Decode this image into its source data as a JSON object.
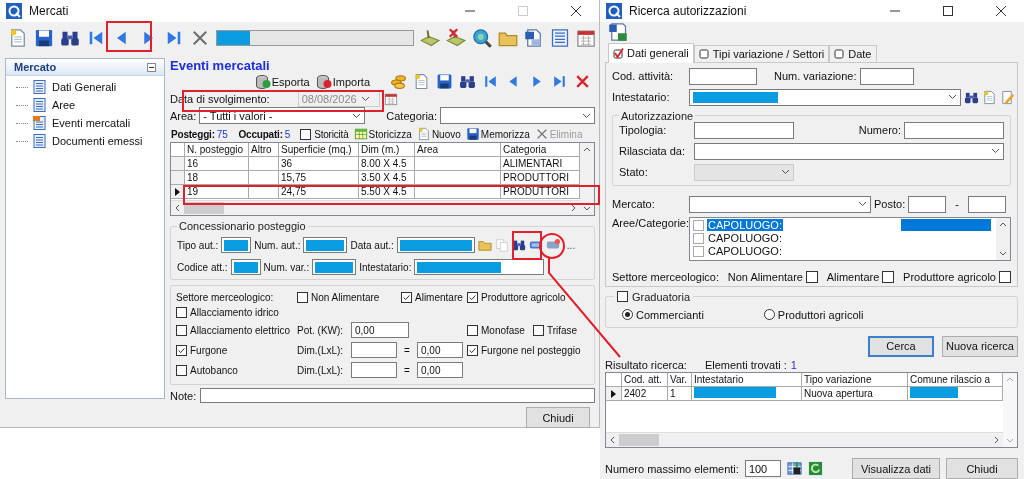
{
  "mercati_window": {
    "title": "Mercati",
    "progress": {
      "level": 0.17
    },
    "sidebar": {
      "header": "Mercato",
      "items": [
        {
          "label": "Dati Generali",
          "selected": false
        },
        {
          "label": "Aree",
          "selected": false
        },
        {
          "label": "Eventi mercatali",
          "selected": true
        },
        {
          "label": "Documenti emessi",
          "selected": false
        }
      ]
    },
    "panel": {
      "title": "Eventi mercatali",
      "transfer_buttons": [
        "Esporta",
        "Importa"
      ],
      "date": {
        "label": "Data di svolgimento:",
        "value": "08/08/2026",
        "disabled": true
      },
      "area": {
        "label": "Area:",
        "value": "- Tutti i valori -"
      },
      "categoria": {
        "label": "Categoria:"
      },
      "counts": [
        {
          "label": "Posteggi:",
          "value": "75"
        },
        {
          "label": "Occupati:",
          "value": "5"
        }
      ],
      "storicita": {
        "label": "Storicità",
        "checked": false
      },
      "commands": [
        {
          "label": "Storicizza",
          "disabled": false
        },
        {
          "label": "Nuovo",
          "disabled": false
        },
        {
          "label": "Memorizza",
          "disabled": false
        },
        {
          "label": "Elimina",
          "disabled": true
        }
      ],
      "table": {
        "columns": [
          "N. posteggio",
          "Altro",
          "Superficie (mq.)",
          "Dim (m.)",
          "Area",
          "Categoria"
        ],
        "rows": [
          {
            "n": "16",
            "superficie": "36",
            "dim": "8.00 X 4.5",
            "categoria": "ALIMENTARI",
            "selected": false
          },
          {
            "n": "18",
            "superficie": "15,75",
            "dim": "3.50 X 4.5",
            "categoria": "PRODUTTORI",
            "selected": false
          },
          {
            "n": "19",
            "superficie": "24,75",
            "dim": "5.50 X 4.5",
            "categoria": "PRODUTTORI",
            "selected": true
          }
        ]
      },
      "concessionario": {
        "title": "Concessionario posteggio",
        "more_button": "...",
        "fields": [
          {
            "label": "Tipo aut.:",
            "redacted": true
          },
          {
            "label": "Num. aut.:",
            "redacted": true
          },
          {
            "label": "Data aut.:",
            "redacted": true
          },
          {
            "label": "Codice att.:",
            "redacted": true
          },
          {
            "label": "Num. var.:",
            "redacted": true
          },
          {
            "label": "Intestatario:",
            "redacted": true
          }
        ]
      },
      "equipment": {
        "settore_label": "Settore merceologico:",
        "settori": [
          {
            "label": "Non Alimentare",
            "checked": false
          },
          {
            "label": "Alimentare",
            "checked": true
          },
          {
            "label": "Produttore agricolo",
            "checked": true
          }
        ],
        "allacciamento_idrico": {
          "label": "Allacciamento idrico",
          "checked": false
        },
        "allacciamento_elettrico": {
          "label": "Allacciamento elettrico",
          "checked": false
        },
        "potenza": {
          "label": "Pot. (KW):",
          "value": "0,00"
        },
        "fasi": [
          {
            "label": "Monofase",
            "checked": false
          },
          {
            "label": "Trifase",
            "checked": false
          }
        ],
        "furgone": {
          "label": "Furgone",
          "checked": true
        },
        "furgone_dim": {
          "label": "Dim.(LxL):",
          "equals": "=",
          "result": "0,00"
        },
        "furgone_posteggio": {
          "label": "Furgone nel posteggio",
          "checked": true
        },
        "autobanco": {
          "label": "Autobanco",
          "checked": false
        },
        "autobanco_dim": {
          "label": "Dim.(LxL):",
          "equals": "=",
          "result": "0,00"
        }
      },
      "note": {
        "label": "Note:"
      },
      "close_button": "Chiudi"
    }
  },
  "ricerca_window": {
    "title": "Ricerca autorizzazioni",
    "tabs": [
      {
        "label": "Dati generali",
        "selected": true,
        "checked": true
      },
      {
        "label": "Tipi variazione / Settori",
        "selected": false,
        "checked": false
      },
      {
        "label": "Date",
        "selected": false,
        "checked": false
      }
    ],
    "cod_attivita": {
      "label": "Cod. attività:"
    },
    "num_variazione": {
      "label": "Num. variazione:"
    },
    "intestatario": {
      "label": "Intestatario:",
      "redacted": true
    },
    "autorizzazione": {
      "title": "Autorizzazione",
      "tipologia": {
        "label": "Tipologia:"
      },
      "numero": {
        "label": "Numero:"
      },
      "rilasciata_da": {
        "label": "Rilasciata da:"
      },
      "stato": {
        "label": "Stato:",
        "disabled": true
      }
    },
    "mercato": {
      "label": "Mercato:"
    },
    "posto": {
      "label": "Posto:",
      "separator": "-"
    },
    "aree": {
      "label": "Aree/Categorie:",
      "items": [
        {
          "label": "CAPOLUOGO:",
          "checked": false,
          "selected": true,
          "redacted": true
        },
        {
          "label": "CAPOLUOGO:",
          "checked": false,
          "selected": false,
          "redacted": false
        },
        {
          "label": "CAPOLUOGO:",
          "checked": false,
          "selected": false,
          "redacted": false
        }
      ]
    },
    "settore": {
      "label": "Settore merceologico:",
      "options": [
        {
          "label": "Non Alimentare",
          "checked": false
        },
        {
          "label": "Alimentare",
          "checked": false
        },
        {
          "label": "Produttore agricolo",
          "checked": false
        }
      ]
    },
    "graduatoria": {
      "label": "Graduatoria",
      "checked": false,
      "options": [
        {
          "label": "Commercianti",
          "selected": true
        },
        {
          "label": "Produttori agricoli",
          "selected": false
        }
      ]
    },
    "search_buttons": [
      {
        "label": "Cerca",
        "default": true
      },
      {
        "label": "Nuova ricerca",
        "default": false
      }
    ],
    "results": {
      "label": "Risultato ricerca:",
      "count_label": "Elementi trovati :",
      "count": "1",
      "columns": [
        "Cod. att.",
        "Var.",
        "Intestatario",
        "Tipo variazione",
        "Comune rilascio a"
      ],
      "rows": [
        {
          "cod": "2402",
          "var": "1",
          "intestatario_redacted": true,
          "tipo": "Nuova apertura",
          "comune_redacted": true,
          "selected": true
        }
      ]
    },
    "max": {
      "label": "Numero massimo elementi:",
      "value": "100"
    },
    "buttons": [
      "Visualizza dati",
      "Chiudi"
    ]
  }
}
